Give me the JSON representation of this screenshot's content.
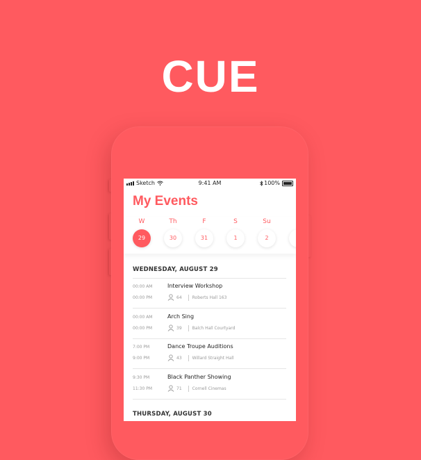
{
  "brand": {
    "title": "CUE"
  },
  "status_bar": {
    "carrier": "Sketch",
    "time": "9:41 AM",
    "battery": "100%"
  },
  "screen_title": "My Events",
  "week": [
    {
      "letter": "W",
      "date": "29",
      "selected": true
    },
    {
      "letter": "Th",
      "date": "30",
      "selected": false
    },
    {
      "letter": "F",
      "date": "31",
      "selected": false
    },
    {
      "letter": "S",
      "date": "1",
      "selected": false
    },
    {
      "letter": "Su",
      "date": "2",
      "selected": false
    }
  ],
  "sections": [
    {
      "header": "WEDNESDAY, AUGUST 29",
      "events": [
        {
          "start": "00:00 AM",
          "end": "00:00 PM",
          "name": "Interview Workshop",
          "attendees": "64",
          "location": "Roberts Hall 163"
        },
        {
          "start": "00:00 AM",
          "end": "00:00 PM",
          "name": "Arch Sing",
          "attendees": "39",
          "location": "Balch Hall Courtyard"
        },
        {
          "start": "7:00 PM",
          "end": "9:00 PM",
          "name": "Dance Troupe Auditions",
          "attendees": "43",
          "location": "Willard Straight Hall"
        },
        {
          "start": "9:30 PM",
          "end": "11:30 PM",
          "name": "Black Panther Showing",
          "attendees": "71",
          "location": "Cornell Cinemas"
        }
      ]
    },
    {
      "header": "THURSDAY, AUGUST 30",
      "events": []
    }
  ],
  "colors": {
    "accent": "#ff5a5f",
    "text": "#222222",
    "muted": "#999999"
  },
  "icons": {
    "attendees": "person-icon",
    "wifi": "wifi-icon",
    "bluetooth": "bluetooth-icon",
    "battery": "battery-icon",
    "signal": "signal-icon"
  }
}
